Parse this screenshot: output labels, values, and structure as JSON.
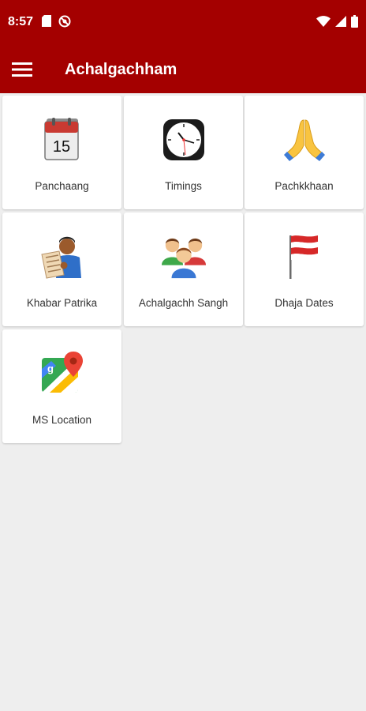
{
  "status_bar": {
    "time": "8:57",
    "left_icons": [
      "sim-card-icon",
      "no-disturb-icon"
    ],
    "right_icons": [
      "wifi-icon",
      "signal-icon",
      "battery-icon"
    ]
  },
  "app_bar": {
    "title": "Achalgachham",
    "menu_icon": "hamburger-menu-icon",
    "color": "#a40000"
  },
  "tiles": [
    {
      "label": "Panchaang",
      "icon": "calendar-icon"
    },
    {
      "label": "Timings",
      "icon": "clock-icon"
    },
    {
      "label": "Pachkkhaan",
      "icon": "folded-hands-icon"
    },
    {
      "label": "Khabar Patrika",
      "icon": "newspaper-reader-icon"
    },
    {
      "label": "Achalgachh Sangh",
      "icon": "people-group-icon"
    },
    {
      "label": "Dhaja Dates",
      "icon": "flag-icon"
    },
    {
      "label": "MS Location",
      "icon": "maps-icon"
    }
  ],
  "calendar_day": "15"
}
